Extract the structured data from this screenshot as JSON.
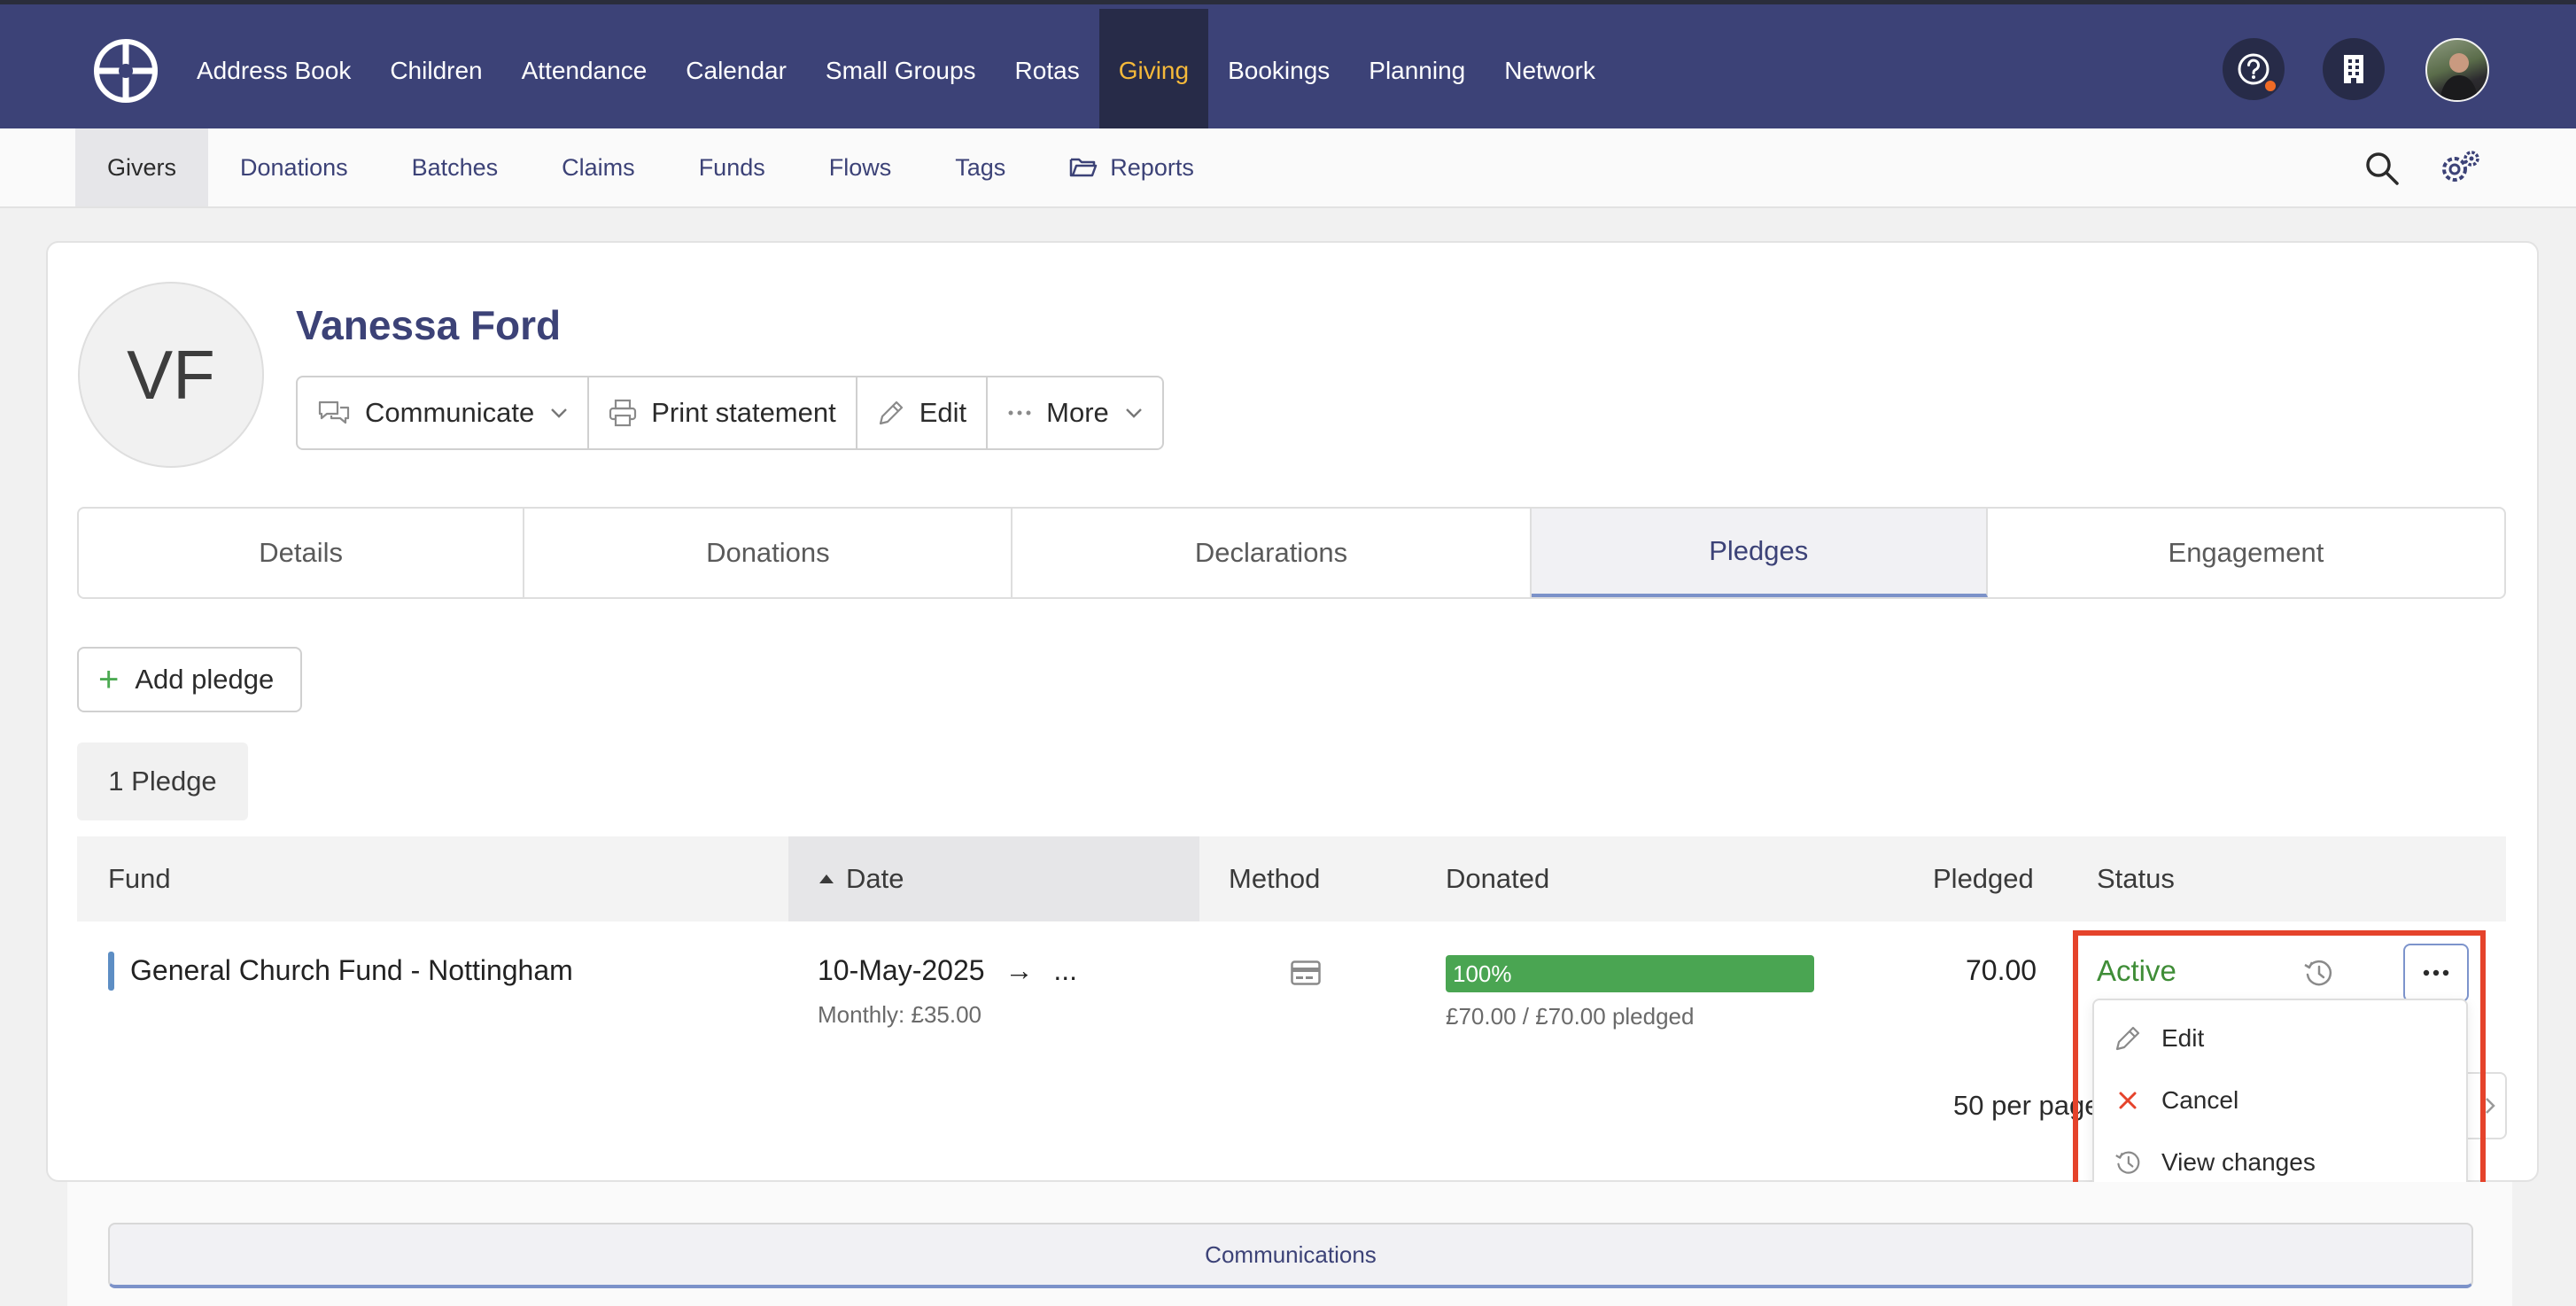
{
  "topnav": {
    "items": [
      {
        "label": "Address Book"
      },
      {
        "label": "Children"
      },
      {
        "label": "Attendance"
      },
      {
        "label": "Calendar"
      },
      {
        "label": "Small Groups"
      },
      {
        "label": "Rotas"
      },
      {
        "label": "Giving",
        "active": true
      },
      {
        "label": "Bookings"
      },
      {
        "label": "Planning"
      },
      {
        "label": "Network"
      }
    ],
    "icons": [
      "logo-icon",
      "help-icon",
      "building-icon",
      "user-avatar"
    ]
  },
  "subnav": {
    "items": [
      {
        "label": "Givers",
        "active": true
      },
      {
        "label": "Donations"
      },
      {
        "label": "Batches"
      },
      {
        "label": "Claims"
      },
      {
        "label": "Funds"
      },
      {
        "label": "Flows"
      },
      {
        "label": "Tags"
      },
      {
        "label": "Reports"
      }
    ]
  },
  "profile": {
    "initials": "VF",
    "name": "Vanessa Ford",
    "actions": {
      "communicate": "Communicate",
      "print": "Print statement",
      "edit": "Edit",
      "more": "More"
    }
  },
  "tabs": [
    {
      "label": "Details"
    },
    {
      "label": "Donations"
    },
    {
      "label": "Declarations"
    },
    {
      "label": "Pledges",
      "active": true
    },
    {
      "label": "Engagement"
    }
  ],
  "pledges": {
    "add_label": "Add pledge",
    "count_label": "1 Pledge",
    "columns": {
      "fund": "Fund",
      "date": "Date",
      "method": "Method",
      "donated": "Donated",
      "pledged": "Pledged",
      "status": "Status"
    },
    "rows": [
      {
        "fund": "General Church Fund - Nottingham",
        "date": "10-May-2025",
        "date_arrow": "→",
        "date_end": "...",
        "frequency": "Monthly: £35.00",
        "donated_percent": 100,
        "donated_percent_label": "100%",
        "donated_detail": "£70.00 / £70.00 pledged",
        "pledged": "70.00",
        "status": "Active"
      }
    ],
    "per_page": "50 per page"
  },
  "row_menu": {
    "items": [
      {
        "label": "Edit"
      },
      {
        "label": "Cancel"
      },
      {
        "label": "View changes"
      }
    ]
  },
  "communications": {
    "label": "Communications"
  },
  "colors": {
    "nav_bg": "#3c4277",
    "nav_active_bg": "#272b48",
    "nav_active_text": "#f5b93a",
    "link": "#3c4277",
    "success": "#4aa552",
    "status_active": "#3f8d37",
    "danger": "#e5432b",
    "accent_border": "#7c92c9"
  }
}
